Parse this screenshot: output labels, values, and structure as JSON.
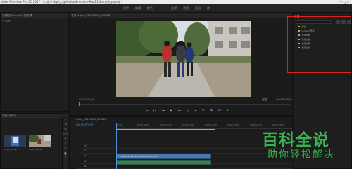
{
  "window": {
    "title": "dobe Premiere Pro CC 2017 - C:\\用户\\dgs\\文档\\Adobe\\Premiere Pro\\11.0\\未命名.prproj *",
    "controls": "—  □  ✕"
  },
  "workspace_tabs": [
    {
      "label": "组件"
    },
    {
      "label": "编辑"
    },
    {
      "label": "颜色"
    },
    {
      "label": "效果"
    },
    {
      "label": "音频"
    },
    {
      "label": "图形"
    },
    {
      "label": "库"
    },
    {
      "label": "»"
    }
  ],
  "source_panel": {
    "tabs": "效果控件  Lumetri 范围  源",
    "line": "(无剪辑)"
  },
  "program_monitor": {
    "tab": "节目: video_20190311_090848",
    "timecode_left": "00;00;00;00",
    "timecode_right": "00;00;17;13",
    "fit": "完整",
    "transport": [
      "◂",
      "|◂",
      "◂◂",
      "▶",
      "▸▸",
      "▸|",
      "▸",
      "⊡",
      "⊞",
      "⊟",
      "+"
    ]
  },
  "project_panel": {
    "tab": "项目: 未命名",
    "items": [
      {
        "label": "video_2019..."
      },
      {
        "label": "video_2019..."
      }
    ]
  },
  "timeline": {
    "tab": "video_20190311_090848",
    "timecode": "00;00;00;00",
    "ruler_ticks": [
      "00;00",
      "00;00;04;00",
      "00;00;08;00",
      "00;00;12;00",
      "00;00;16;00",
      "00;00;20;00",
      "00;00;24;00",
      "00;00;28;00"
    ],
    "tracks": [
      "V3",
      "V2",
      "V1",
      "A1",
      "A2"
    ],
    "clip_label": "video_20190311_090848.mp4 [V]"
  },
  "effects_panel": {
    "tab": "效果",
    "tree": [
      {
        "label": "预设"
      },
      {
        "label": "Lumetri 预设"
      },
      {
        "label": "音频效果"
      },
      {
        "label": "音频过渡"
      },
      {
        "label": "视频效果"
      },
      {
        "label": "视频过渡"
      }
    ]
  },
  "tools": [
    "▸",
    "⇥",
    "⇔",
    "⟷",
    "✂",
    "⧄",
    "✎",
    "✋",
    "T"
  ],
  "watermark": {
    "top": "百科全说",
    "bottom": "助你轻松解决"
  },
  "colors": {
    "accent_blue": "#4d8fdc",
    "highlight_red": "#e02020",
    "watermark_green": "#37b24d"
  }
}
